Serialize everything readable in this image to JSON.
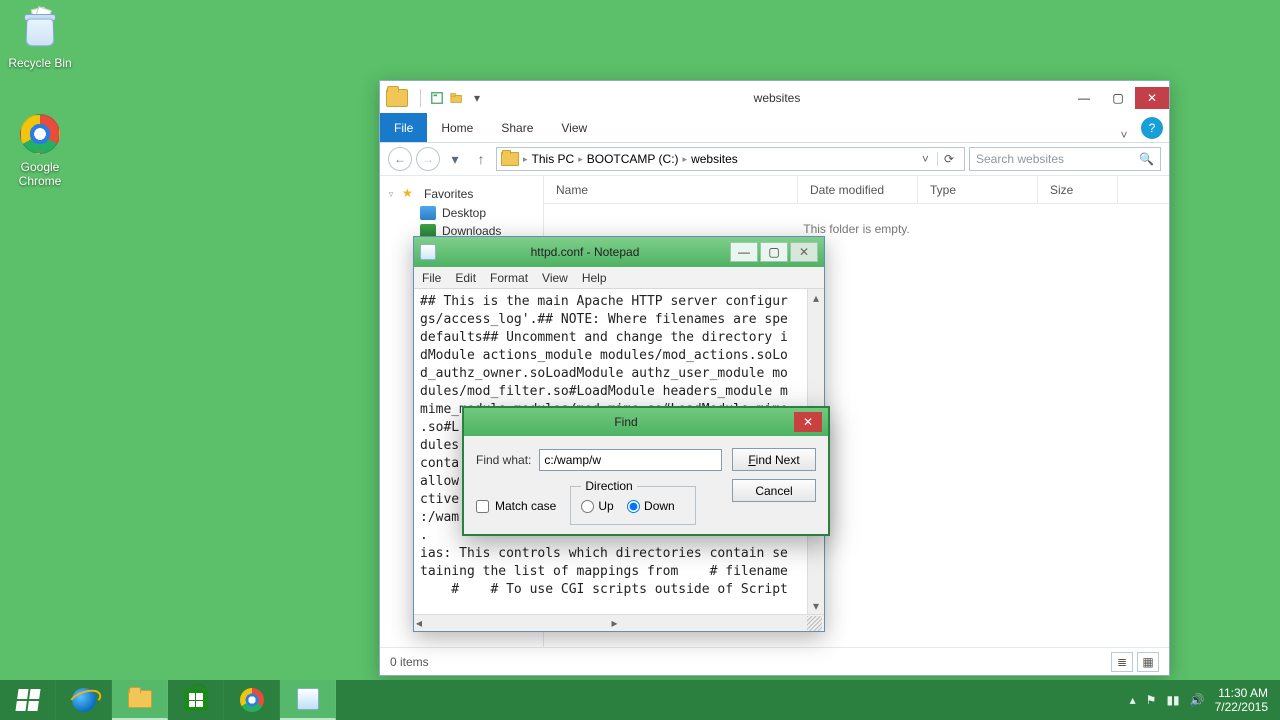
{
  "desktop": {
    "recycle_label": "Recycle Bin",
    "chrome_label": "Google Chrome"
  },
  "explorer": {
    "title": "websites",
    "tabs": {
      "file": "File",
      "home": "Home",
      "share": "Share",
      "view": "View"
    },
    "breadcrumb": [
      "This PC",
      "BOOTCAMP (C:)",
      "websites"
    ],
    "search_placeholder": "Search websites",
    "nav": {
      "favorites": "Favorites",
      "desktop": "Desktop",
      "downloads": "Downloads"
    },
    "columns": {
      "name": "Name",
      "date": "Date modified",
      "type": "Type",
      "size": "Size"
    },
    "empty_message": "This folder is empty.",
    "status": "0 items"
  },
  "notepad": {
    "title": "httpd.conf - Notepad",
    "menu": [
      "File",
      "Edit",
      "Format",
      "View",
      "Help"
    ],
    "lines": [
      "## This is the main Apache HTTP server configur",
      "gs/access_log'.## NOTE: Where filenames are spe",
      "defaults## Uncomment and change the directory i",
      "dModule actions_module modules/mod_actions.soLo",
      "d_authz_owner.soLoadModule authz_user_module mo",
      "dules/mod_filter.so#LoadModule headers_module m",
      "mime_module modules/mod_mime.so#LoadModule mime",
      ".so#L",
      "dules",
      "conta",
      "allow",
      "ctive",
      ":/wam",
      ".",
      "ias: This controls which directories contain se",
      "taining the list of mappings from    # filename",
      "    #    # To use CGI scripts outside of Script"
    ]
  },
  "find": {
    "title": "Find",
    "label_find_what": "Find what:",
    "find_value": "c:/wamp/w",
    "btn_find_next": "Find Next",
    "btn_cancel": "Cancel",
    "match_case": "Match case",
    "direction_legend": "Direction",
    "opt_up": "Up",
    "opt_down": "Down"
  },
  "taskbar": {
    "time": "11:30 AM",
    "date": "7/22/2015"
  }
}
